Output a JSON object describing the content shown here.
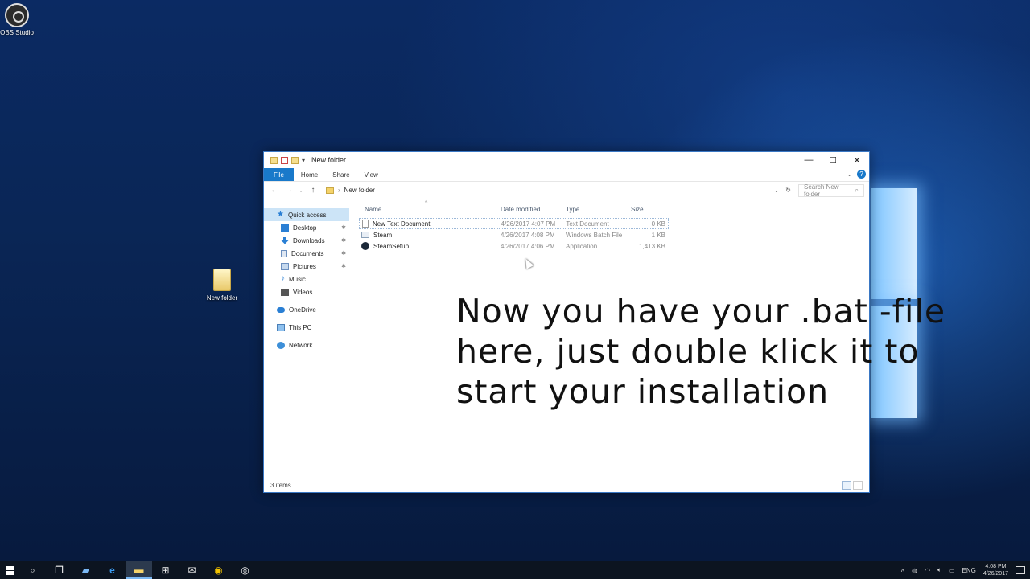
{
  "desktop": {
    "icons": [
      {
        "label": "OBS Studio"
      },
      {
        "label": "New folder"
      }
    ]
  },
  "window": {
    "title": "New folder",
    "controls": {
      "minimize": "—",
      "maximize": "☐",
      "close": "✕"
    }
  },
  "ribbon": {
    "tabs": [
      "File",
      "Home",
      "Share",
      "View"
    ],
    "help": "?"
  },
  "address": {
    "path": "New folder",
    "search_placeholder": "Search New folder"
  },
  "navpane": {
    "quick_access": "Quick access",
    "items": [
      "Desktop",
      "Downloads",
      "Documents",
      "Pictures",
      "Music",
      "Videos"
    ],
    "onedrive": "OneDrive",
    "this_pc": "This PC",
    "network": "Network"
  },
  "files": {
    "headers": {
      "name": "Name",
      "date": "Date modified",
      "type": "Type",
      "size": "Size"
    },
    "rows": [
      {
        "name": "New Text Document",
        "date": "4/26/2017 4:07 PM",
        "type": "Text Document",
        "size": "0 KB",
        "icon": "text-file-icon"
      },
      {
        "name": "Steam",
        "date": "4/26/2017 4:08 PM",
        "type": "Windows Batch File",
        "size": "1 KB",
        "icon": "batch-file-icon"
      },
      {
        "name": "SteamSetup",
        "date": "4/26/2017 4:06 PM",
        "type": "Application",
        "size": "1,413 KB",
        "icon": "steam-app-icon"
      }
    ]
  },
  "caption": {
    "line1": "Now you have your .bat -file",
    "line2": "here, just double klick it to",
    "line3": "start your installation"
  },
  "status": {
    "items_count": "3 items"
  },
  "taskbar": {
    "tray_lang": "ENG",
    "time": "4:08 PM",
    "date": "4/26/2017"
  }
}
